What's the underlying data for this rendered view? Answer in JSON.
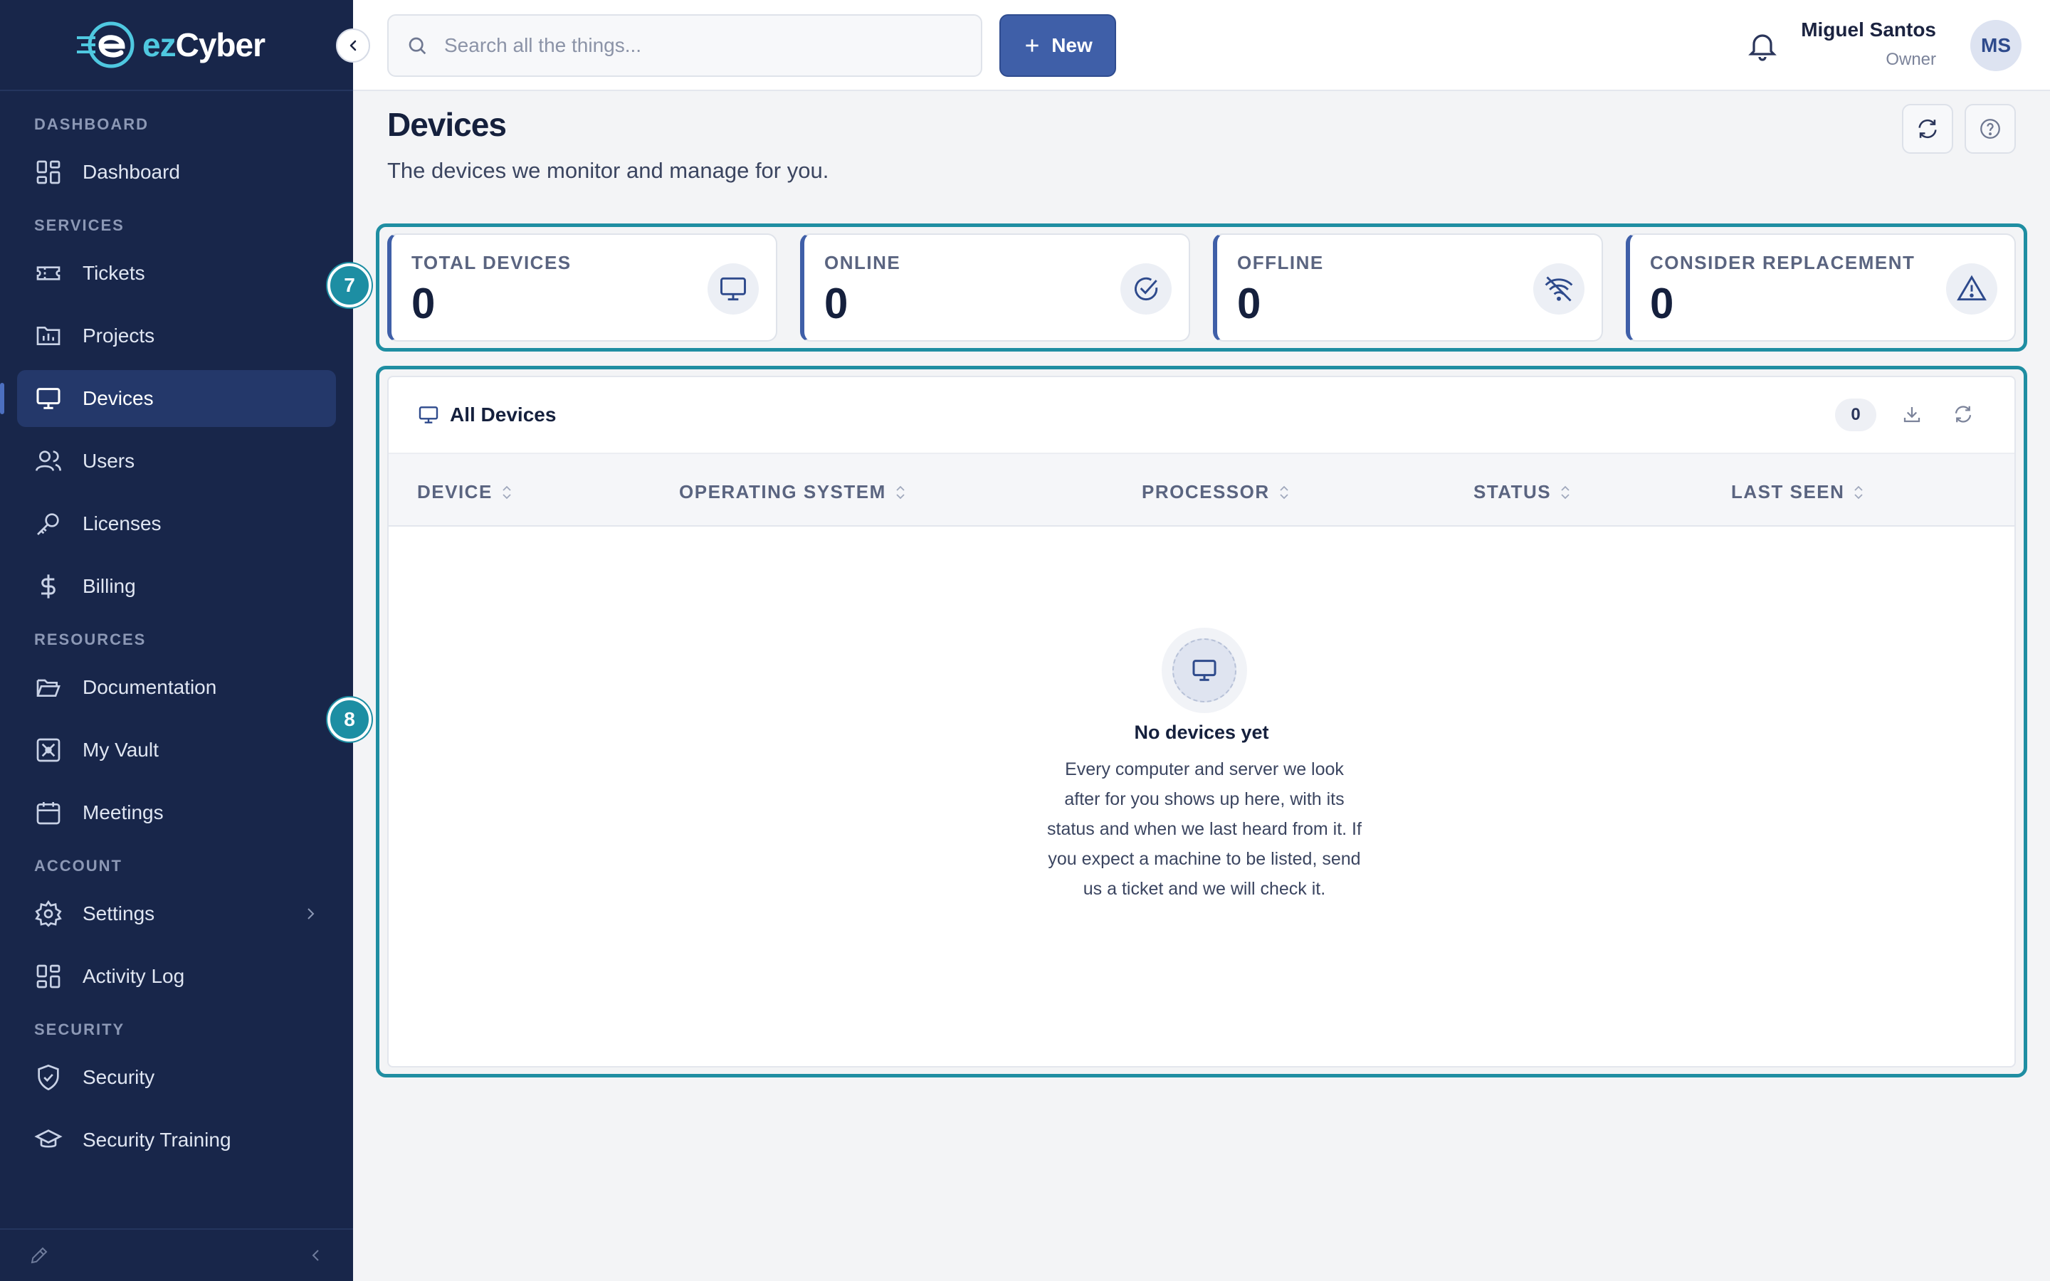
{
  "app": {
    "logo_prefix": "ez",
    "logo_suffix": "Cyber"
  },
  "sidebar": {
    "sections": [
      {
        "title": "DASHBOARD",
        "items": [
          {
            "label": "Dashboard",
            "icon": "grid-icon"
          }
        ]
      },
      {
        "title": "SERVICES",
        "items": [
          {
            "label": "Tickets",
            "icon": "ticket-icon"
          },
          {
            "label": "Projects",
            "icon": "chart-folder-icon"
          },
          {
            "label": "Devices",
            "icon": "monitor-icon",
            "active": true
          },
          {
            "label": "Users",
            "icon": "users-icon"
          },
          {
            "label": "Licenses",
            "icon": "key-icon"
          },
          {
            "label": "Billing",
            "icon": "dollar-icon"
          }
        ]
      },
      {
        "title": "RESOURCES",
        "items": [
          {
            "label": "Documentation",
            "icon": "folder-open-icon"
          },
          {
            "label": "My Vault",
            "icon": "vault-icon"
          },
          {
            "label": "Meetings",
            "icon": "calendar-icon"
          }
        ]
      },
      {
        "title": "ACCOUNT",
        "items": [
          {
            "label": "Settings",
            "icon": "gear-icon",
            "has_submenu": true
          },
          {
            "label": "Activity Log",
            "icon": "grid-icon"
          }
        ]
      },
      {
        "title": "SECURITY",
        "items": [
          {
            "label": "Security",
            "icon": "shield-icon"
          },
          {
            "label": "Security Training",
            "icon": "graduation-cap-icon"
          }
        ]
      }
    ]
  },
  "topbar": {
    "search_placeholder": "Search all the things...",
    "new_label": "New",
    "user_name": "Miguel Santos",
    "user_role": "Owner",
    "avatar_initials": "MS"
  },
  "page": {
    "title": "Devices",
    "subtitle": "The devices we monitor and manage for you."
  },
  "markers": {
    "stats": "7",
    "table": "8"
  },
  "stats": [
    {
      "label": "TOTAL DEVICES",
      "value": "0",
      "icon": "monitor-icon"
    },
    {
      "label": "ONLINE",
      "value": "0",
      "icon": "check-circle-icon"
    },
    {
      "label": "OFFLINE",
      "value": "0",
      "icon": "wifi-off-icon"
    },
    {
      "label": "CONSIDER REPLACEMENT",
      "value": "0",
      "icon": "warning-icon"
    }
  ],
  "table": {
    "title": "All Devices",
    "count": "0",
    "columns": [
      "DEVICE",
      "OPERATING SYSTEM",
      "PROCESSOR",
      "STATUS",
      "LAST SEEN"
    ],
    "rows": [],
    "empty_title": "No devices yet",
    "empty_text": "Every computer and server we look after for you shows up here, with its status and when we last heard from it. If you expect a machine to be listed, send us a ticket and we will check it."
  },
  "colors": {
    "sidebar_bg": "#18264a",
    "accent": "#3f5fa8",
    "highlight_outline": "#1f8ea2"
  }
}
